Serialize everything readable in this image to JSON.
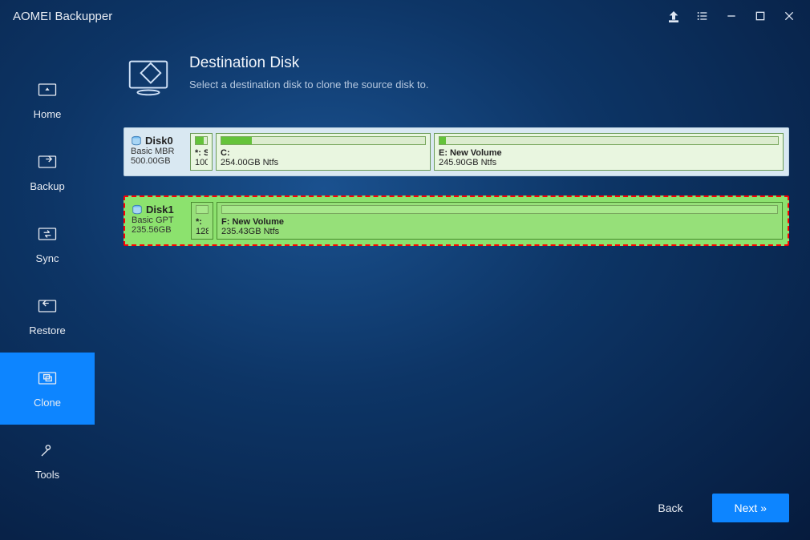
{
  "app_title": "AOMEI Backupper",
  "titlebar_icons": [
    "upgrade",
    "menu-list",
    "minimize",
    "maximize",
    "close"
  ],
  "sidebar": {
    "items": [
      {
        "label": "Home",
        "icon": "home"
      },
      {
        "label": "Backup",
        "icon": "backup"
      },
      {
        "label": "Sync",
        "icon": "sync"
      },
      {
        "label": "Restore",
        "icon": "restore"
      },
      {
        "label": "Clone",
        "icon": "clone"
      },
      {
        "label": "Tools",
        "icon": "tools"
      }
    ],
    "active_index": 4
  },
  "page": {
    "title": "Destination Disk",
    "subtitle": "Select a destination disk to clone the source disk to."
  },
  "disks": [
    {
      "name": "Disk0",
      "type": "Basic MBR",
      "size": "500.00GB",
      "selected": false,
      "partitions": [
        {
          "label": "*: S",
          "size": "100.",
          "usage": 0.7,
          "flex": 28
        },
        {
          "label": "C:",
          "size": "254.00GB Ntfs",
          "usage": 0.15,
          "flex": 268
        },
        {
          "label": "E: New Volume",
          "size": "245.90GB Ntfs",
          "usage": 0.02,
          "flex": 260
        }
      ]
    },
    {
      "name": "Disk1",
      "type": "Basic GPT",
      "size": "235.56GB",
      "selected": true,
      "partitions": [
        {
          "label": "*:",
          "size": "128.",
          "usage": 0.0,
          "flex": 28
        },
        {
          "label": "F: New Volume",
          "size": "235.43GB Ntfs",
          "usage": 0.0,
          "flex": 530
        }
      ]
    }
  ],
  "footer": {
    "back": "Back",
    "next": "Next »"
  }
}
